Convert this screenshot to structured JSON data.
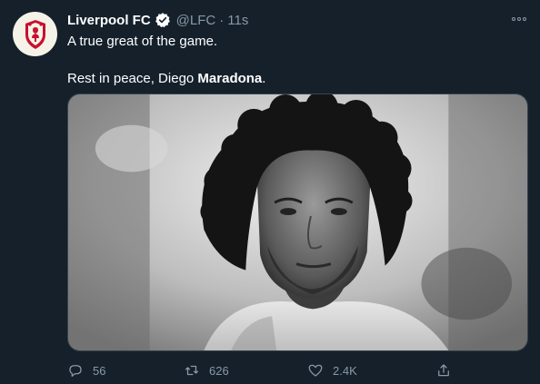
{
  "tweet": {
    "display_name": "Liverpool FC",
    "verified": true,
    "handle": "@LFC",
    "separator": "·",
    "time": "11s",
    "text_line1": "A true great of the game.",
    "text_line2_prefix": "Rest in peace, Diego ",
    "text_line2_bold": "Maradona",
    "text_line2_suffix": ".",
    "media": {
      "type": "photo",
      "style": "black-and-white portrait"
    }
  },
  "actions": {
    "reply_count": "56",
    "retweet_count": "626",
    "like_count": "2.4K"
  },
  "icons": {
    "avatar": "liverbird-crest-icon",
    "verified": "verified-badge-icon",
    "more": "more-options-icon",
    "reply": "reply-icon",
    "retweet": "retweet-icon",
    "like": "heart-icon",
    "share": "share-icon"
  },
  "colors": {
    "background": "#15202b",
    "text": "#ffffff",
    "muted": "#8899a6",
    "crest_red": "#c8102e"
  }
}
